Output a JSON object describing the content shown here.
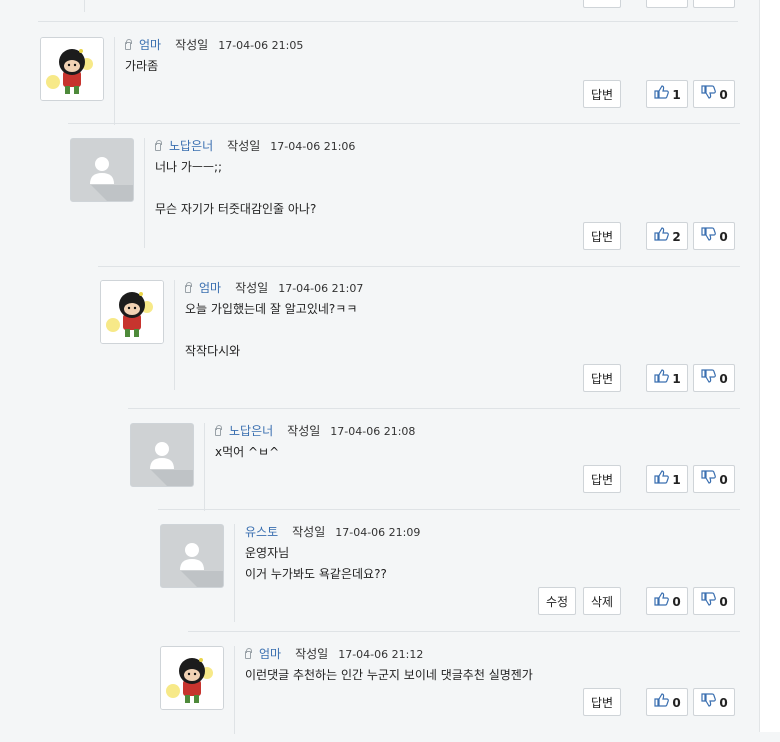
{
  "labels": {
    "date_label": "작성일",
    "reply": "답변",
    "edit": "수정",
    "delete": "삭제"
  },
  "icons": {
    "private": "lock-icon",
    "like": "thumbs-up-icon",
    "dislike": "thumbs-down-icon",
    "default_avatar": "person-icon"
  },
  "colors": {
    "author": "#3a6fb0",
    "background": "#f4f6f7"
  },
  "comments": [
    {
      "author": "엄마",
      "date": "17-04-06 21:05",
      "lines": [
        "가라좀"
      ],
      "likes": "1",
      "dislikes": "0",
      "avatar": "cartoon",
      "locked": true,
      "owner": false
    },
    {
      "author": "노답은너",
      "date": "17-04-06 21:06",
      "lines": [
        "너나 가ㅡㅡ;;",
        "",
        "무슨 자기가 터줏대감인줄 아나?"
      ],
      "likes": "2",
      "dislikes": "0",
      "avatar": "default",
      "locked": true,
      "owner": false
    },
    {
      "author": "엄마",
      "date": "17-04-06 21:07",
      "lines": [
        "오늘 가입했는데 잘 알고있네?ㅋㅋ",
        "",
        "작작다시와"
      ],
      "likes": "1",
      "dislikes": "0",
      "avatar": "cartoon",
      "locked": true,
      "owner": false
    },
    {
      "author": "노답은너",
      "date": "17-04-06 21:08",
      "lines": [
        "x먹어 ^ㅂ^"
      ],
      "likes": "1",
      "dislikes": "0",
      "avatar": "default",
      "locked": true,
      "owner": false
    },
    {
      "author": "유스토",
      "date": "17-04-06 21:09",
      "lines": [
        "운영자님",
        "이거 누가봐도 욕같은데요??"
      ],
      "likes": "0",
      "dislikes": "0",
      "avatar": "default",
      "locked": false,
      "owner": true
    },
    {
      "author": "엄마",
      "date": "17-04-06 21:12",
      "lines": [
        "이런댓글 추천하는 인간 누군지 보이네 댓글추천 실명젠가"
      ],
      "likes": "0",
      "dislikes": "0",
      "avatar": "cartoon",
      "locked": true,
      "owner": false
    }
  ]
}
